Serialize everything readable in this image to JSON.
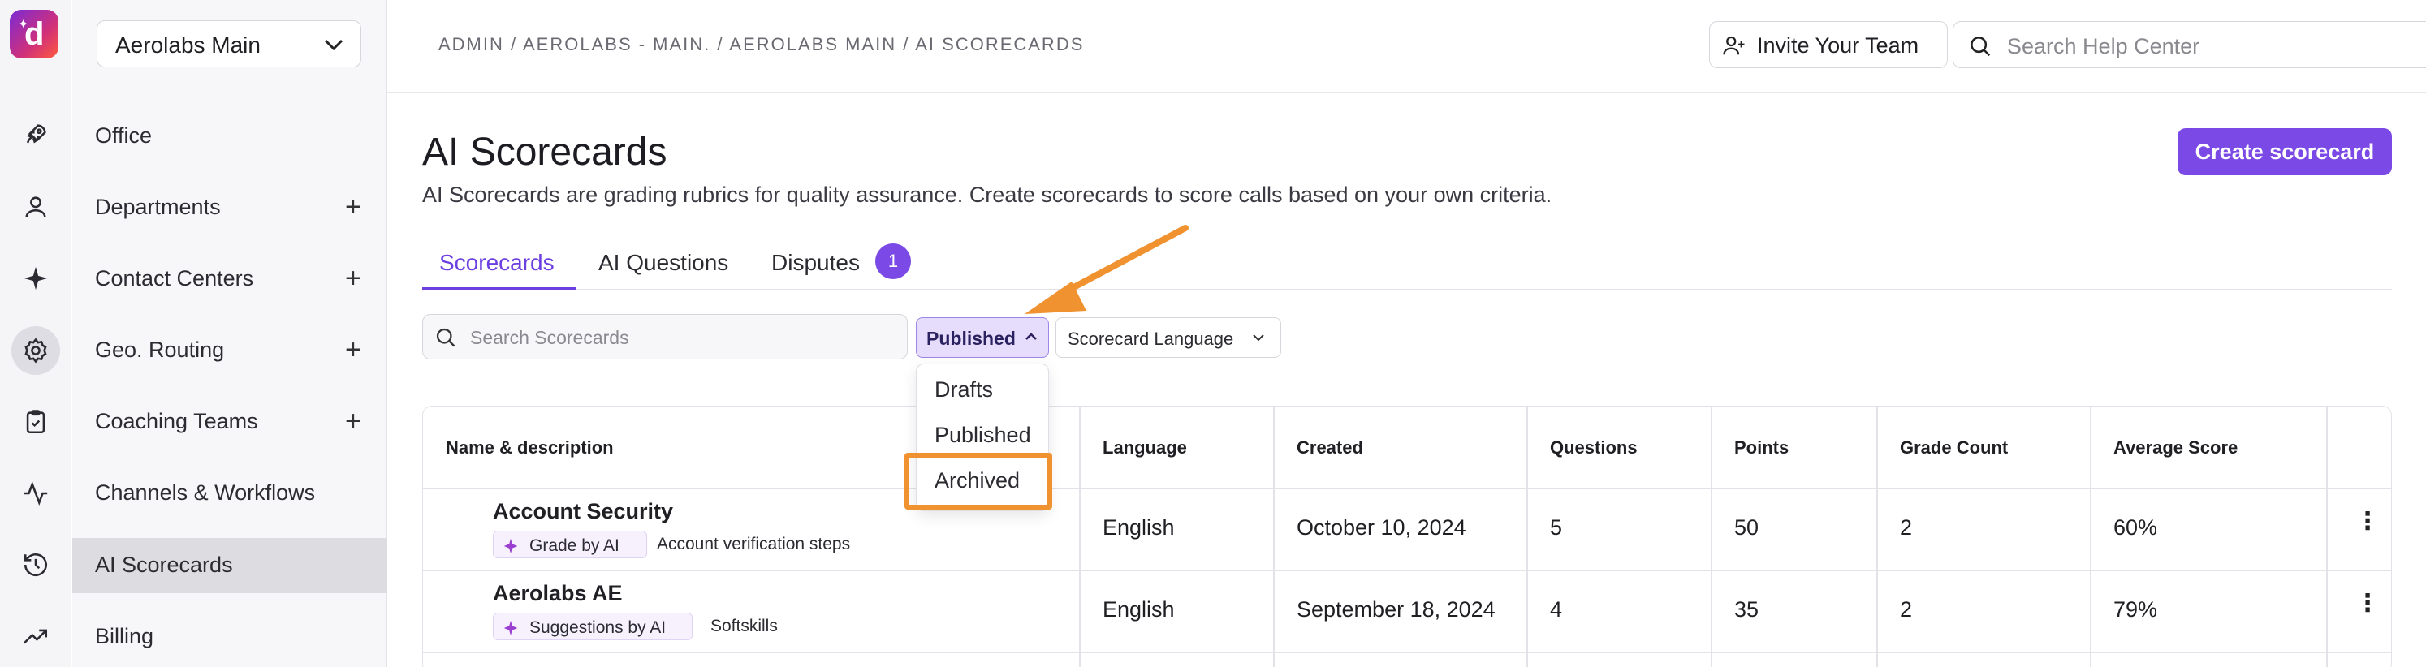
{
  "app": {
    "logo_letter": "d"
  },
  "rail": [
    "rocket-icon",
    "user-icon",
    "sparkle-icon",
    "gear-icon",
    "clipboard-icon",
    "activity-icon",
    "history-icon",
    "trending-icon"
  ],
  "sidebar": {
    "workspace": "Aerolabs Main",
    "items": [
      {
        "label": "Office"
      },
      {
        "label": "Departments",
        "plus": "+"
      },
      {
        "label": "Contact Centers",
        "plus": "+"
      },
      {
        "label": "Geo. Routing",
        "plus": "+"
      },
      {
        "label": "Coaching Teams",
        "plus": "+"
      },
      {
        "label": "Channels & Workflows"
      },
      {
        "label": "AI Scorecards"
      },
      {
        "label": "Billing"
      }
    ]
  },
  "header": {
    "breadcrumb": "ADMIN / AEROLABS - MAIN. / AEROLABS MAIN / AI SCORECARDS",
    "invite_label": "Invite Your Team",
    "help_placeholder": "Search Help Center"
  },
  "page": {
    "title": "AI Scorecards",
    "subtitle": "AI Scorecards are grading rubrics for quality assurance. Create scorecards to score calls based on your own criteria.",
    "create_label": "Create scorecard"
  },
  "tabs": [
    {
      "label": "Scorecards"
    },
    {
      "label": "AI Questions"
    },
    {
      "label": "Disputes",
      "badge": "1"
    }
  ],
  "filters": {
    "search_placeholder": "Search Scorecards",
    "status_selected": "Published",
    "language_label": "Scorecard Language",
    "status_options": [
      "Drafts",
      "Published",
      "Archived"
    ]
  },
  "table": {
    "columns": [
      "Name & description",
      "Language",
      "Created",
      "Questions",
      "Points",
      "Grade Count",
      "Average Score"
    ],
    "rows": [
      {
        "name": "Account Security",
        "tag": "Grade by AI",
        "desc": "Account verification steps",
        "language": "English",
        "created": "October 10, 2024",
        "questions": "5",
        "points": "50",
        "grade_count": "2",
        "average": "60%"
      },
      {
        "name": "Aerolabs AE",
        "tag": "Suggestions by AI",
        "desc": "Softskills",
        "language": "English",
        "created": "September 18, 2024",
        "questions": "4",
        "points": "35",
        "grade_count": "2",
        "average": "79%"
      }
    ]
  },
  "colors": {
    "accent": "#7b4ae6",
    "highlight": "#f0922f"
  }
}
